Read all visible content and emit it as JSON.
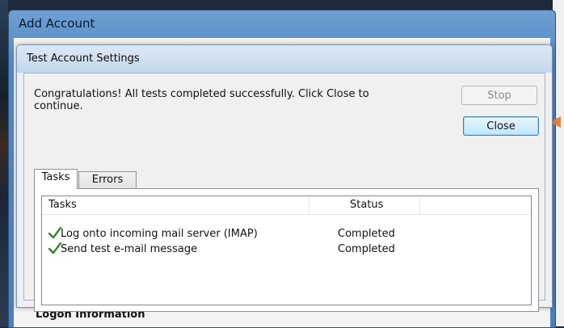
{
  "outer_window": {
    "title": "Add Account",
    "bottom_label": "Logon Information"
  },
  "dialog": {
    "title": "Test Account Settings",
    "message": "Congratulations! All tests completed successfully. Click Close to continue.",
    "stop_label": "Stop",
    "close_label": "Close"
  },
  "tabs": [
    {
      "label": "Tasks",
      "selected": true
    },
    {
      "label": "Errors",
      "selected": false
    }
  ],
  "task_list": {
    "columns": [
      "Tasks",
      "Status"
    ],
    "rows": [
      {
        "task": "Log onto incoming mail server (IMAP)",
        "status": "Completed",
        "icon": "checkmark-icon"
      },
      {
        "task": "Send test e-mail message",
        "status": "Completed",
        "icon": "checkmark-icon"
      }
    ]
  },
  "colors": {
    "checkmark": "#2f8a2a",
    "close_button_border": "#3c7fb1",
    "arrow": "#e8823a"
  }
}
